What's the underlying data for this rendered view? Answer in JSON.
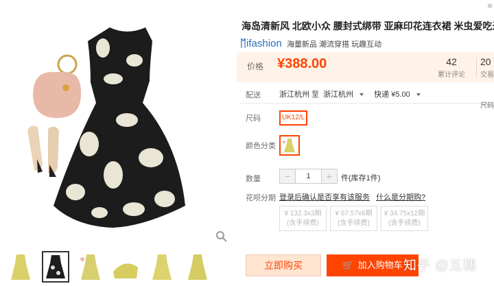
{
  "product": {
    "title": "海岛清新风 北欧小众 腰封式绑带 亚麻印花连衣裙 米虫爱吃米"
  },
  "brand": {
    "logo_text": "ifashion",
    "tags": "海量新品 潮流穿搭 玩趣互动"
  },
  "price": {
    "label": "价格",
    "value": "¥388.00"
  },
  "stats": {
    "reviews_count": "42",
    "reviews_label": "累计评论",
    "sales_count": "20",
    "sales_label": "交易成"
  },
  "shipping": {
    "label": "配送",
    "from": "浙江杭州 至",
    "to": "浙江杭州",
    "method": "快递 ¥5.00"
  },
  "right_edge_text": "尺码",
  "size": {
    "label": "尺码",
    "option": "UK12/L"
  },
  "color": {
    "label": "颜色分类"
  },
  "quantity": {
    "label": "数量",
    "minus": "−",
    "plus": "+",
    "value": "1",
    "stock": "件(库存1件)"
  },
  "installment": {
    "label": "花呗分期",
    "note": "登录后确认是否享有该服务",
    "link": "什么是分期购?",
    "options": [
      {
        "amount": "¥ 132.3x3期",
        "fee": "(含手续费)"
      },
      {
        "amount": "¥ 67.57x6期",
        "fee": "(含手续费)"
      },
      {
        "amount": "¥ 34.75x12期",
        "fee": "(含手续费)"
      }
    ]
  },
  "actions": {
    "buy_now": "立即购买",
    "add_cart": "加入购物车"
  },
  "watermark": "知乎 @五穗",
  "colors": {
    "accent": "#ff4400",
    "price_bg": "#fff2e8",
    "brand_blue": "#2a6ebb"
  }
}
